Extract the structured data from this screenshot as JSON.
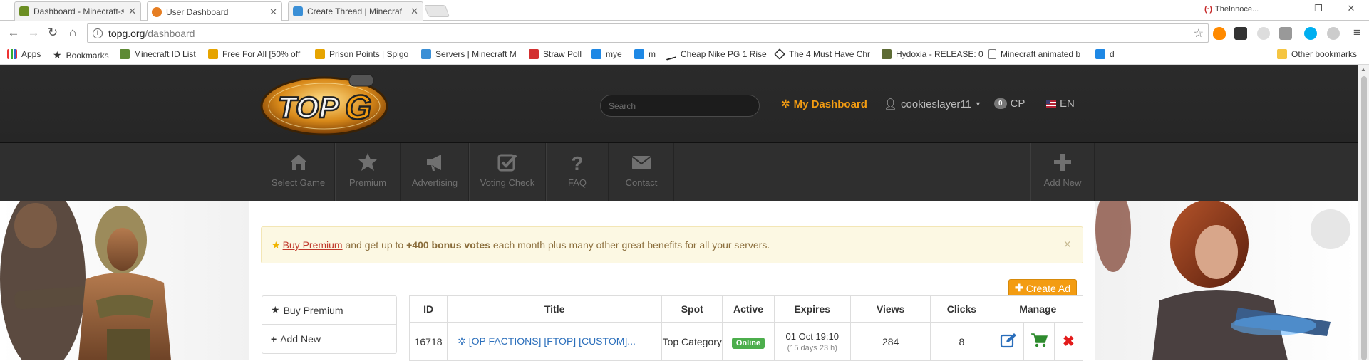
{
  "tabs": [
    {
      "title": "Dashboard - Minecraft-s",
      "color": "#6b8e23"
    },
    {
      "title": "User Dashboard",
      "color": "#e67e22"
    },
    {
      "title": "Create Thread | Minecraf",
      "color": "#3a8fd6"
    }
  ],
  "profile_name": "TheInnoce...",
  "address": {
    "host": "topg.org",
    "path": "/dashboard"
  },
  "bookmarks": [
    "Apps",
    "Bookmarks",
    "Minecraft ID List",
    "Free For All [50% off",
    "Prison Points | Spigo",
    "Servers | Minecraft M",
    "Straw Poll",
    "mye",
    "m",
    "Cheap Nike PG 1 Rise",
    "The 4 Must Have Chr",
    "Hydoxia - RELEASE: 0",
    "Minecraft animated b",
    "d",
    "Other bookmarks"
  ],
  "header": {
    "search_placeholder": "Search",
    "dashboard": "My Dashboard",
    "user": "cookieslayer11",
    "cp_count": "0",
    "cp_label": "CP",
    "lang": "EN"
  },
  "nav": [
    {
      "label": "Select Game",
      "icon": "home-icon"
    },
    {
      "label": "Premium",
      "icon": "star-icon"
    },
    {
      "label": "Advertising",
      "icon": "megaphone-icon"
    },
    {
      "label": "Voting Check",
      "icon": "check-square-icon"
    },
    {
      "label": "FAQ",
      "icon": "question-icon"
    },
    {
      "label": "Contact",
      "icon": "envelope-icon"
    },
    {
      "label": "Add New",
      "icon": "plus-icon"
    }
  ],
  "alert": {
    "link": "Buy Premium",
    "text1": " and get up to ",
    "bold": "+400 bonus votes",
    "text2": " each month plus many other great benefits for all your servers.",
    "close": "×"
  },
  "create_ad": "Create Ad",
  "side_menu": [
    {
      "label": "Buy Premium",
      "icon": "star-icon"
    },
    {
      "label": "Add New",
      "icon": "plus-icon"
    }
  ],
  "table": {
    "headers": [
      "ID",
      "Title",
      "Spot",
      "Active",
      "Expires",
      "Views",
      "Clicks",
      "Manage"
    ],
    "rows": [
      {
        "id": "16718",
        "title": "[OP FACTIONS] [FTOP] [CUSTOM]...",
        "spot": "Top Category",
        "active": "Online",
        "expires": "01 Oct 19:10",
        "expires_sub": "(15 days 23 h)",
        "views": "284",
        "clicks": "8"
      }
    ]
  },
  "colors": {
    "accent": "#f39c12",
    "online": "#4cae4c",
    "link": "#2a6ebb",
    "delete": "#e31b1b",
    "cart": "#2e8b2e"
  }
}
